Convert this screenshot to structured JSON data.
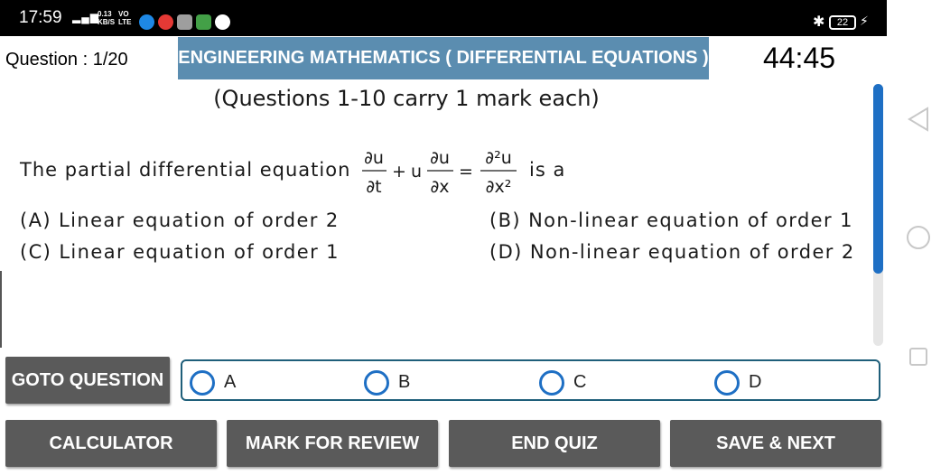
{
  "status_bar": {
    "time": "17:59",
    "signal": "4G",
    "speed": "0.13 KB/S",
    "volte": "VO LTE",
    "battery": "22"
  },
  "header": {
    "question_number": "Question : 1/20",
    "subject": "ENGINEERING MATHEMATICS ( DIFFERENTIAL EQUATIONS )",
    "timer": "44:45"
  },
  "question": {
    "instructions": "(Questions 1-10 carry 1 mark each)",
    "stem_prefix": "The partial differential equation",
    "stem_suffix": "is a",
    "equation": {
      "t1_num": "∂u",
      "t1_den": "∂t",
      "plus": "+",
      "u": "u",
      "t2_num": "∂u",
      "t2_den": "∂x",
      "eq": "=",
      "t3_num": "∂²u",
      "t3_den": "∂x²"
    },
    "options": [
      {
        "label": "(A)",
        "text": "Linear equation of order 2"
      },
      {
        "label": "(B)",
        "text": "Non-linear equation of order 1"
      },
      {
        "label": "(C)",
        "text": "Linear equation of order 1"
      },
      {
        "label": "(D)",
        "text": "Non-linear equation of order 2"
      }
    ]
  },
  "answer": {
    "goto_label": "GOTO QUESTION",
    "choices": [
      "A",
      "B",
      "C",
      "D"
    ]
  },
  "buttons": {
    "calculator": "CALCULATOR",
    "mark_review": "MARK FOR REVIEW",
    "end_quiz": "END QUIZ",
    "save_next": "SAVE & NEXT"
  },
  "colors": {
    "subject_bar": "#5b8db0",
    "button_gray": "#5a5a5a",
    "accent_blue": "#1e6fc4",
    "answer_border": "#1f5f7a"
  }
}
